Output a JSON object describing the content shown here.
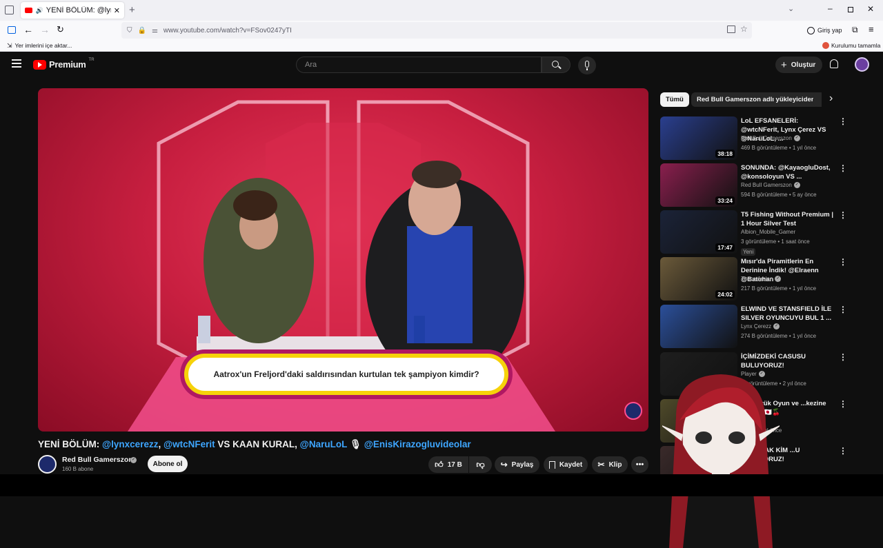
{
  "browser": {
    "tab_title": "YENİ BÖLÜM: @lynxcerezz,",
    "url": "www.youtube.com/watch?v=FSov0247yTI",
    "signin_label": "Giriş yap",
    "import_bookmarks": "Yer imlerini içe aktar...",
    "finish_setup": "Kurulumu tamamla"
  },
  "masthead": {
    "logo_text": "Premium",
    "logo_badge": "TR",
    "search_placeholder": "Ara",
    "create_label": "Oluştur"
  },
  "video": {
    "question": "Aatrox'un Freljord'daki saldırısından kurtulan tek şampiyon kimdir?",
    "title_prefix": "YENİ BÖLÜM: ",
    "title_m1": "@lynxcerezz",
    "title_sep1": ", ",
    "title_m2": "@wtcNFerit",
    "title_mid": " VS KAAN KURAL, ",
    "title_m3": "@NaruLoL",
    "title_mic": " 🎙 ",
    "title_m4": "@EnisKirazogluvideolar"
  },
  "channel": {
    "name": "Red Bull Gamerszon",
    "subs": "160 B abone",
    "subscribe_label": "Abone ol",
    "likes": "17 B",
    "share_label": "Paylaş",
    "save_label": "Kaydet",
    "clip_label": "Klip"
  },
  "chips": [
    "Tümü",
    "Red Bull Gamerszon adlı yükleyiciden"
  ],
  "recommendations": [
    {
      "title": "LoL EFSANELERİ: @wtcNFerit, Lynx Çerez VS @NaruLoL, ...",
      "channel": "Red Bull Gamerszon",
      "meta": "469 B görüntüleme • 1 yıl önce",
      "duration": "38:18",
      "color": "#2a3f8f"
    },
    {
      "title": "SONUNDA: @KayaogluDost, @konsoloyun VS ...",
      "channel": "Red Bull Gamerszon",
      "meta": "594 B görüntüleme • 5 ay önce",
      "duration": "33:24",
      "color": "#8a1f4e"
    },
    {
      "title": "T5 Fishing Without Premium | 1 Hour Silver Test",
      "channel": "Albion_Mobile_Gamer",
      "meta": "3 görüntüleme • 1 saat önce",
      "duration": "17:47",
      "badge": "Yeni",
      "color": "#1b2338"
    },
    {
      "title": "Mısır'da Piramitlerin En Derinine İndik! @Elraenn @Batuhan ...",
      "channel": "Tunca Arslan",
      "meta": "217 B görüntüleme • 1 yıl önce",
      "duration": "24:02",
      "color": "#6b5a3a"
    },
    {
      "title": "ELWIND VE STANSFIELD İLE SILVER OYUNCUYU BUL 1 ...",
      "channel": "Lynx Çerezz",
      "meta": "274 B görüntüleme • 1 yıl önce",
      "duration": "",
      "color": "#2b4f9a"
    },
    {
      "title": "İÇİMİZDEKİ CASUSU BULUYORUZ!",
      "channel": "Player",
      "meta": "... görüntüleme • 2 yıl önce",
      "duration": "",
      "color": "#1e1e1e"
    },
    {
      "title": "En Büyük Oyun ve ...kezine Gittim! 🇯🇵🍒",
      "channel": "",
      "meta": "...me • 1 yıl önce",
      "duration": "",
      "color": "#4f4a2a"
    },
    {
      "title": "SORARAK KİM ...U BULUYORUZ!",
      "channel": "",
      "meta": "",
      "duration": "",
      "color": "#3a2a2a"
    }
  ]
}
